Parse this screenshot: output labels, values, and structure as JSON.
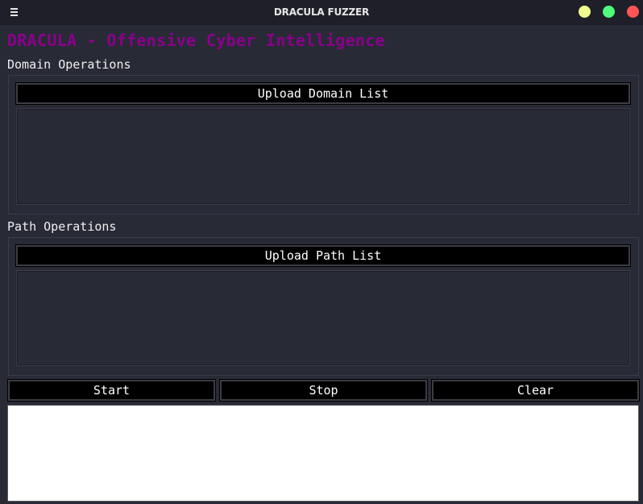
{
  "window": {
    "title": "DRACULA FUZZER",
    "controls": {
      "minimize_color": "#f1fa8c",
      "maximize_color": "#50fa7b",
      "close_color": "#ff5555"
    }
  },
  "app": {
    "title": "DRACULA - Offensive Cyber Intelligence",
    "title_color": "#8b008b"
  },
  "domain_section": {
    "label": "Domain Operations",
    "upload_button": "Upload Domain List"
  },
  "path_section": {
    "label": "Path Operations",
    "upload_button": "Upload Path List"
  },
  "actions": {
    "start": "Start",
    "stop": "Stop",
    "clear": "Clear"
  },
  "icons": {
    "menu": "hamburger-menu-icon"
  }
}
